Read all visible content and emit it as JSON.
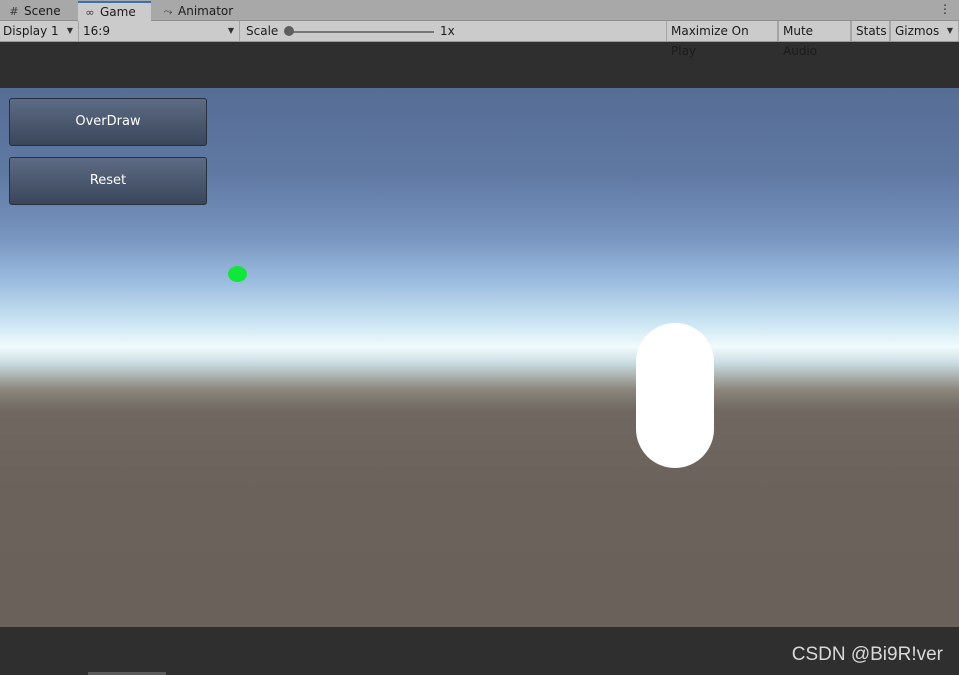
{
  "tabs": [
    {
      "label": "Scene",
      "icon": "grid-icon"
    },
    {
      "label": "Game",
      "icon": "gamepad-icon",
      "active": true
    },
    {
      "label": "Animator",
      "icon": "animator-icon"
    }
  ],
  "toolbar": {
    "display": "Display 1",
    "aspect": "16:9",
    "scale_label": "Scale",
    "scale_value": "1x",
    "maximize_on_play": "Maximize On Play",
    "mute_audio": "Mute Audio",
    "stats": "Stats",
    "gizmos": "Gizmos"
  },
  "game": {
    "buttons": {
      "overdraw": "OverDraw",
      "reset": "Reset"
    },
    "colors": {
      "green_dot": "#11e63a",
      "capsule": "#ffffff"
    }
  },
  "watermark": "CSDN @Bi9R!ver"
}
